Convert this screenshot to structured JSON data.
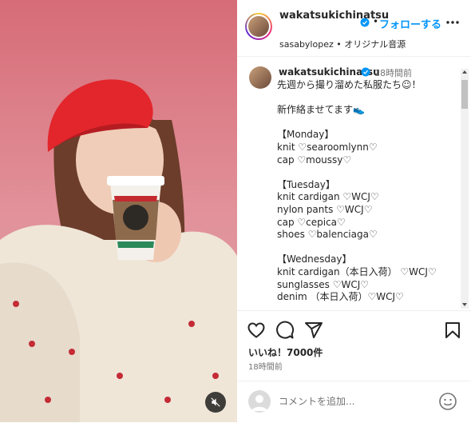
{
  "header": {
    "username": "wakatsukichinatsu",
    "separator": "•",
    "follow_label": "フォローする",
    "subline": "sasabylopez • オリジナル音源"
  },
  "caption": {
    "username": "wakatsukichinatsu",
    "time": "18時間前",
    "lines": [
      "先週から撮り溜めた私服たち☺︎！",
      "",
      "新作絡ませてます👟",
      "",
      "【Monday】",
      "knit ♡searoomlynn♡",
      "cap ♡moussy♡",
      "",
      "【Tuesday】",
      "knit cardigan ♡WCJ♡",
      "nylon pants ♡WCJ♡",
      "cap ♡cepica♡",
      "shoes ♡balenciaga♡",
      "",
      "【Wednesday】",
      "knit cardigan（本日入荷） ♡WCJ♡",
      "sunglasses ♡WCJ♡",
      "denim （本日入荷）♡WCJ♡"
    ]
  },
  "stats": {
    "likes": "いいね！7000件",
    "post_time": "18時間前"
  },
  "composer": {
    "placeholder": "コメントを追加..."
  },
  "icons": {
    "like": "heart-icon",
    "comment": "comment-icon",
    "share": "send-icon",
    "save": "bookmark-icon",
    "more": "more-icon",
    "emoji": "emoji-icon",
    "mute": "muted-speaker-icon",
    "verified": "verified-badge-icon"
  },
  "colors": {
    "accent": "#0095f6",
    "text": "#262626",
    "secondary": "#737373",
    "border": "#efefef"
  }
}
